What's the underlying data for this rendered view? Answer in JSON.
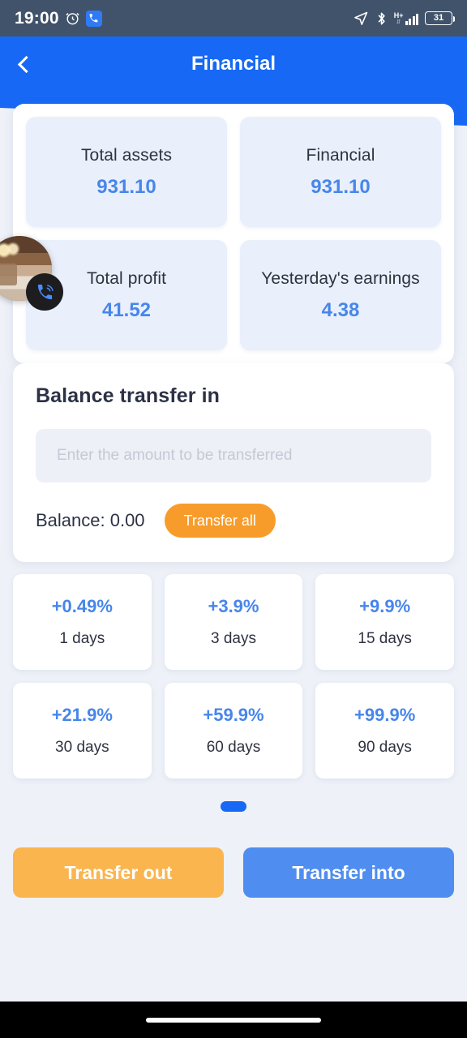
{
  "status_bar": {
    "time": "19:00",
    "alarm_icon": "alarm-clock-icon",
    "call_icon": "phone-call-icon",
    "location_icon": "navigation-arrow-icon",
    "bluetooth_icon": "bluetooth-icon",
    "network_type": "H+",
    "signal_icon": "signal-bars-icon",
    "battery_level": "31",
    "background_color": "#41536b"
  },
  "header": {
    "title": "Financial",
    "back_icon": "chevron-left-icon",
    "background_color": "#1769f5"
  },
  "stats": {
    "tiles": [
      {
        "label": "Total assets",
        "value": "931.10"
      },
      {
        "label": "Financial",
        "value": "931.10"
      },
      {
        "label": "Total profit",
        "value": "41.52"
      },
      {
        "label": "Yesterday's earnings",
        "value": "4.38"
      }
    ],
    "value_color": "#4786ea",
    "tile_background": "#e9effb"
  },
  "call_bubble": {
    "avatar_name": "video-call-thumbnail",
    "badge_icon": "phone-call-icon"
  },
  "transfer": {
    "title": "Balance transfer in",
    "amount_placeholder": "Enter the amount to be transferred",
    "amount_value": "",
    "balance_label": "Balance: 0.00",
    "transfer_all_label": "Transfer all",
    "transfer_all_color": "#f79c2a"
  },
  "rates": [
    {
      "percent": "+0.49%",
      "days": "1 days"
    },
    {
      "percent": "+3.9%",
      "days": "3 days"
    },
    {
      "percent": "+9.9%",
      "days": "15 days"
    },
    {
      "percent": "+21.9%",
      "days": "30 days"
    },
    {
      "percent": "+59.9%",
      "days": "60 days"
    },
    {
      "percent": "+99.9%",
      "days": "90 days"
    }
  ],
  "pager": {
    "active_index": 0,
    "dot_color": "#1769f5"
  },
  "actions": {
    "transfer_out_label": "Transfer out",
    "transfer_out_color": "#fab54f",
    "transfer_into_label": "Transfer into",
    "transfer_into_color": "#4f8ef0"
  },
  "nav_bar": {
    "home_indicator": "home-gesture-bar"
  }
}
